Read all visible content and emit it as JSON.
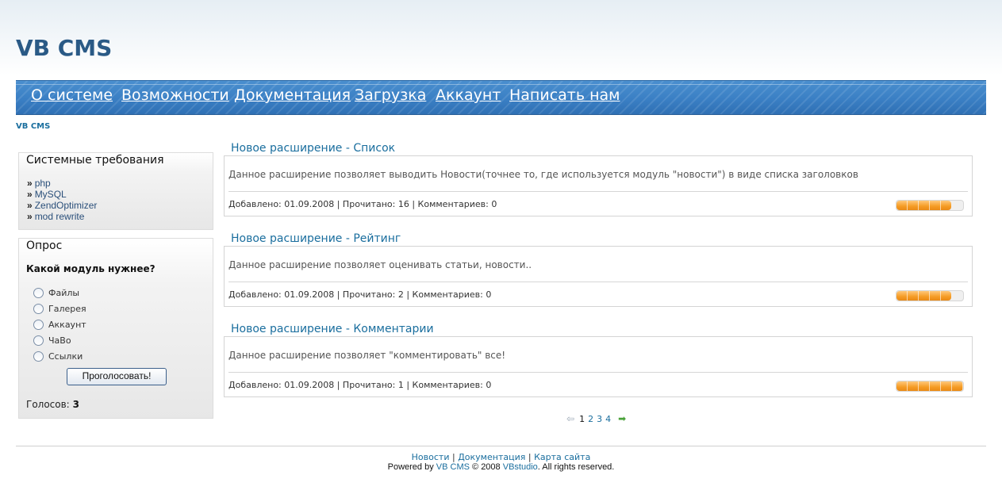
{
  "site": {
    "logo": "VB CMS",
    "breadcrumb": "VB CMS"
  },
  "nav": [
    {
      "label": "О системе"
    },
    {
      "label": "Возможности"
    },
    {
      "label": "Документация"
    },
    {
      "label": "Загрузка"
    },
    {
      "label": "Аккаунт"
    },
    {
      "label": "Написать нам"
    }
  ],
  "sidebar": {
    "requirements": {
      "title": "Системные требования",
      "bullet": "»",
      "items": [
        "php",
        "MySQL",
        "ZendOptimizer",
        "mod rewrite"
      ]
    },
    "poll": {
      "title": "Опрос",
      "question": "Какой модуль нужнее?",
      "options": [
        "Файлы",
        "Галерея",
        "Аккаунт",
        "ЧаВо",
        "Ссылки"
      ],
      "vote_button": "Проголосовать!",
      "votes_label": "Голосов:",
      "votes_count": "3"
    }
  },
  "articles": [
    {
      "title": "Новое расширение - Список",
      "text": "Данное расширение позволяет выводить Новости(точнее то, где используется модуль \"новости\") в виде списка заголовков",
      "meta": "Добавлено: 01.09.2008 | Прочитано: 16 | Комментариев: 0",
      "rating": 0.82
    },
    {
      "title": "Новое расширение - Рейтинг",
      "text": "Данное расширение позволяет оценивать статьи, новости..",
      "meta": "Добавлено: 01.09.2008 | Прочитано: 2 | Комментариев: 0",
      "rating": 0.82
    },
    {
      "title": "Новое расширение - Комментарии",
      "text": "Данное расширение позволяет \"комментировать\" все!",
      "meta": "Добавлено: 01.09.2008 | Прочитано: 1 | Комментариев: 0",
      "rating": 1.0
    }
  ],
  "pager": {
    "prev_icon": "arrow-left-icon",
    "current": "1",
    "pages": [
      "2",
      "3",
      "4"
    ],
    "next_icon": "arrow-right-icon"
  },
  "footer": {
    "links": [
      "Новости",
      "Документация",
      "Карта сайта"
    ],
    "separator": "|",
    "copy_prefix": "Powered by",
    "copy_brand": "VB CMS",
    "copy_middle": "© 2008",
    "copy_company": "VBstudio",
    "copy_suffix": ". All rights reserved."
  },
  "colors": {
    "nav_bg": "#3a7fc4",
    "link": "#1a6e9e",
    "logo": "#2a5a86",
    "rating": "#f59b24"
  }
}
